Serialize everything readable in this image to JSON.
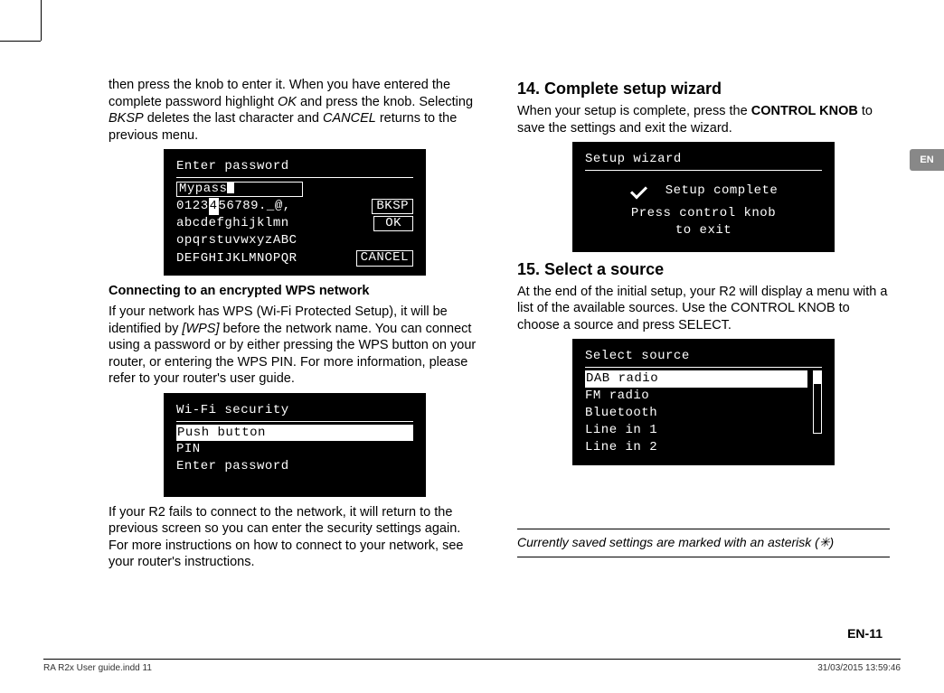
{
  "lang_tab": "EN",
  "left": {
    "para1_a": "then press the knob to enter it. When you have entered the complete password highlight ",
    "para1_ok": "OK",
    "para1_b": " and press the knob. Selecting ",
    "para1_bksp": "BKSP",
    "para1_c": " deletes the last character and ",
    "para1_cancel": "CANCEL",
    "para1_d": " returns to the previous menu.",
    "screen1": {
      "title": "Enter password",
      "input": "Mypass",
      "row1": "0123456789._@,",
      "row1_hl_index": 4,
      "row2": " abcdefghijklmn",
      "row3": "opqrstuvwxyzABC",
      "row4": "DEFGHIJKLMNOPQR",
      "btn1": "BKSP",
      "btn2": "OK",
      "btn3": "CANCEL"
    },
    "subhead": "Connecting to an encrypted WPS network",
    "para2_a": "If your network has WPS (Wi-Fi Protected Setup), it will be identified by ",
    "para2_wps": "[WPS]",
    "para2_b": " before the network name. You can connect using a password or by either pressing the WPS button on your router, or entering the WPS PIN. For more information, please refer to your router's user guide.",
    "screen2": {
      "title": "Wi-Fi security",
      "opt1": "Push button",
      "opt2": "PIN",
      "opt3": "Enter password"
    },
    "para3": "If your R2 fails to connect to the network, it will return to the previous screen so you can enter the security settings again. For more instructions on how to connect to your network, see your router's instructions."
  },
  "right": {
    "h14": "14. Complete setup wizard",
    "p14_a": "When your setup is complete, press the ",
    "p14_knob": "CONTROL KNOB",
    "p14_b": " to save the settings and exit the wizard.",
    "screen3": {
      "title": "Setup wizard",
      "line1": "Setup complete",
      "line2": "Press control knob",
      "line3": "to exit"
    },
    "h15": "15. Select a source",
    "p15": "At the end of the initial setup, your R2 will display a menu with a list of the available sources. Use the CONTROL KNOB to choose a source and press SELECT.",
    "screen4": {
      "title": "Select source",
      "items": [
        "DAB radio",
        "FM radio",
        "Bluetooth",
        "Line in 1",
        "Line in 2"
      ]
    },
    "footnote_a": "Currently saved settings are marked with an asterisk (",
    "footnote_star": "✳",
    "footnote_b": ")"
  },
  "page_num": "EN-11",
  "footer_left": "RA R2x User guide.indd   11",
  "footer_right": "31/03/2015   13:59:46"
}
